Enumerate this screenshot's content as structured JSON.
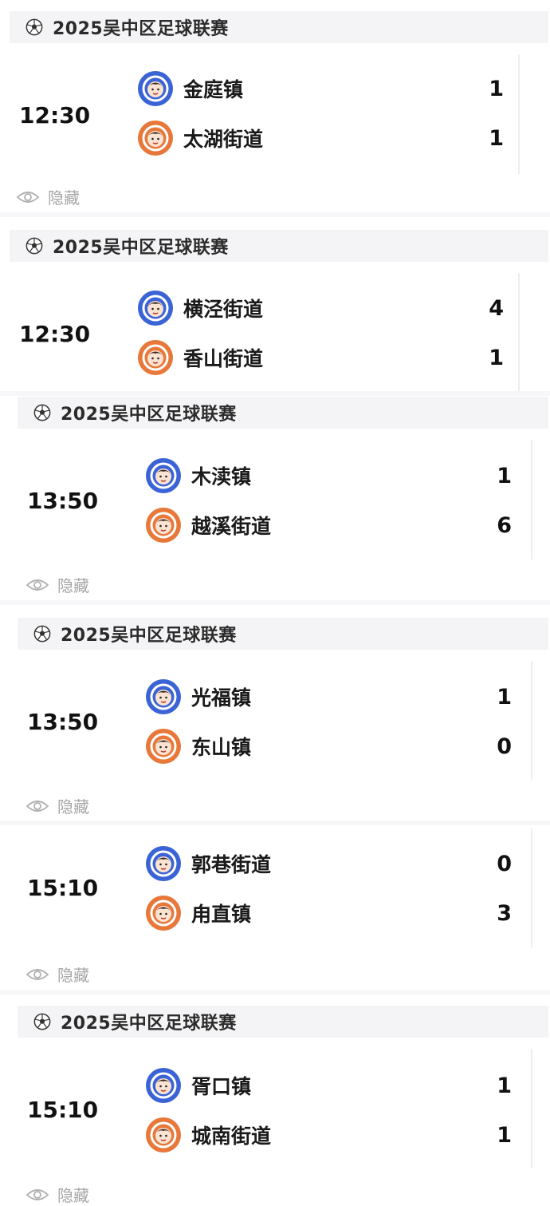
{
  "league_title": "2025吴中区足球联赛",
  "hide_label": "隐藏",
  "matches": [
    {
      "time": "12:30",
      "home": {
        "name": "金庭镇",
        "score": "1"
      },
      "away": {
        "name": "太湖街道",
        "score": "1"
      }
    },
    {
      "time": "12:30",
      "home": {
        "name": "横泾街道",
        "score": "4"
      },
      "away": {
        "name": "香山街道",
        "score": "1"
      }
    },
    {
      "time": "13:50",
      "home": {
        "name": "木渎镇",
        "score": "1"
      },
      "away": {
        "name": "越溪街道",
        "score": "6"
      }
    },
    {
      "time": "13:50",
      "home": {
        "name": "光福镇",
        "score": "1"
      },
      "away": {
        "name": "东山镇",
        "score": "0"
      }
    },
    {
      "time": "15:10",
      "home": {
        "name": "郭巷街道",
        "score": "0"
      },
      "away": {
        "name": "甪直镇",
        "score": "3"
      }
    },
    {
      "time": "15:10",
      "home": {
        "name": "胥口镇",
        "score": "1"
      },
      "away": {
        "name": "城南街道",
        "score": "1"
      }
    }
  ],
  "colors": {
    "home_crest": "#3a63d6",
    "away_crest": "#e8783a",
    "bar_bg": "#f4f4f6",
    "muted": "#a6a6a6"
  },
  "icons": {
    "league": "soccer-ball-icon",
    "hide": "eye-icon",
    "team": "team-crest-icon"
  }
}
